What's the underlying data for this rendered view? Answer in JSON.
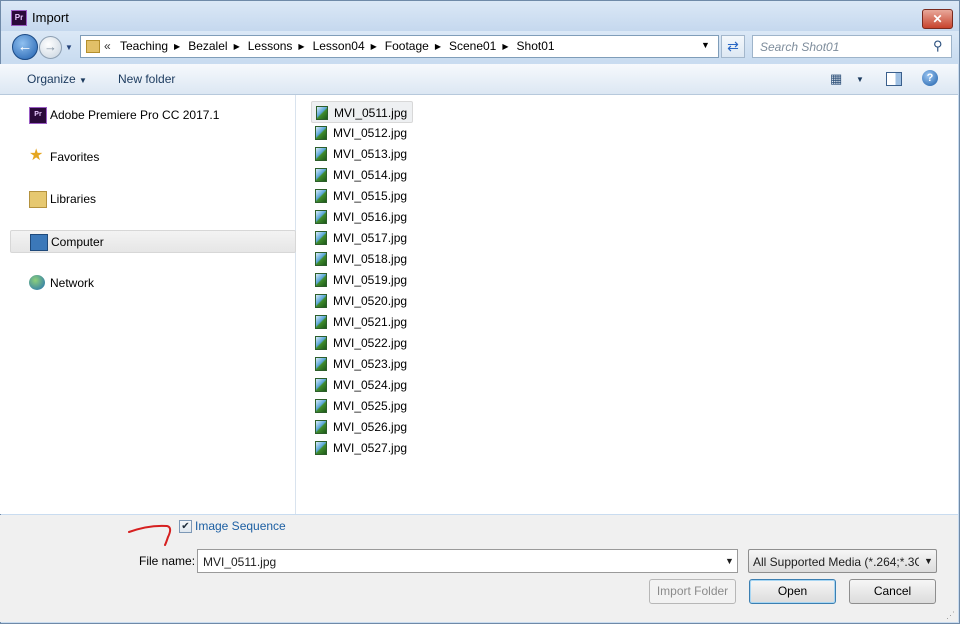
{
  "window": {
    "title": "Import",
    "app_logo_text": "Pr"
  },
  "navigation": {
    "breadcrumb_overflow": "«",
    "breadcrumbs": [
      "Teaching",
      "Bezalel",
      "Lessons",
      "Lesson04",
      "Footage",
      "Scene01",
      "Shot01"
    ],
    "search_placeholder": "Search Shot01"
  },
  "toolbar": {
    "organize_label": "Organize",
    "new_folder_label": "New folder"
  },
  "nav_pane": {
    "items": [
      {
        "label": "Adobe Premiere Pro CC 2017.1",
        "icon": "premiere-icon",
        "selected": false
      },
      {
        "label": "Favorites",
        "icon": "star-icon",
        "selected": false
      },
      {
        "label": "Libraries",
        "icon": "library-icon",
        "selected": false
      },
      {
        "label": "Computer",
        "icon": "computer-icon",
        "selected": true
      },
      {
        "label": "Network",
        "icon": "network-icon",
        "selected": false
      }
    ]
  },
  "files": {
    "selected_index": 0,
    "items": [
      "MVI_0511.jpg",
      "MVI_0512.jpg",
      "MVI_0513.jpg",
      "MVI_0514.jpg",
      "MVI_0515.jpg",
      "MVI_0516.jpg",
      "MVI_0517.jpg",
      "MVI_0518.jpg",
      "MVI_0519.jpg",
      "MVI_0520.jpg",
      "MVI_0521.jpg",
      "MVI_0522.jpg",
      "MVI_0523.jpg",
      "MVI_0524.jpg",
      "MVI_0525.jpg",
      "MVI_0526.jpg",
      "MVI_0527.jpg"
    ]
  },
  "options": {
    "image_sequence_label": "Image Sequence",
    "image_sequence_checked": true
  },
  "file_name": {
    "label": "File name:",
    "value": "MVI_0511.jpg"
  },
  "file_type": {
    "value": "All Supported Media (*.264;*.3G"
  },
  "buttons": {
    "import_folder": "Import Folder",
    "open": "Open",
    "cancel": "Cancel"
  },
  "colors": {
    "window_frame": "#c9dcf0",
    "link_blue": "#1c5fa3",
    "annotation_red": "#d62020"
  }
}
